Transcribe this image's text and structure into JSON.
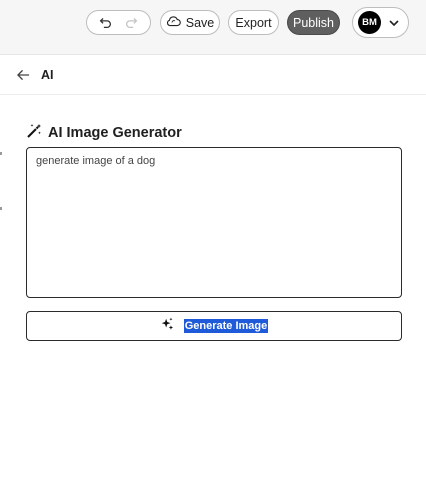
{
  "toolbar": {
    "undo_icon": "undo-icon",
    "redo_icon": "redo-icon",
    "save_label": "Save",
    "save_icon": "cloud-sync-icon",
    "export_label": "Export",
    "publish_label": "Publish"
  },
  "user": {
    "initials": "BM",
    "menu_icon": "chevron-down-icon"
  },
  "panel": {
    "back_icon": "arrow-left-icon",
    "title": "AI"
  },
  "generator": {
    "icon": "magic-wand-icon",
    "title": "AI Image Generator",
    "prompt_value": "generate image of a dog",
    "button_icon": "sparkles-icon",
    "button_label": "Generate Image"
  },
  "colors": {
    "publish_bg": "#5f5f5f",
    "selection_highlight": "#1f5bd8",
    "avatar_bg": "#000000"
  }
}
